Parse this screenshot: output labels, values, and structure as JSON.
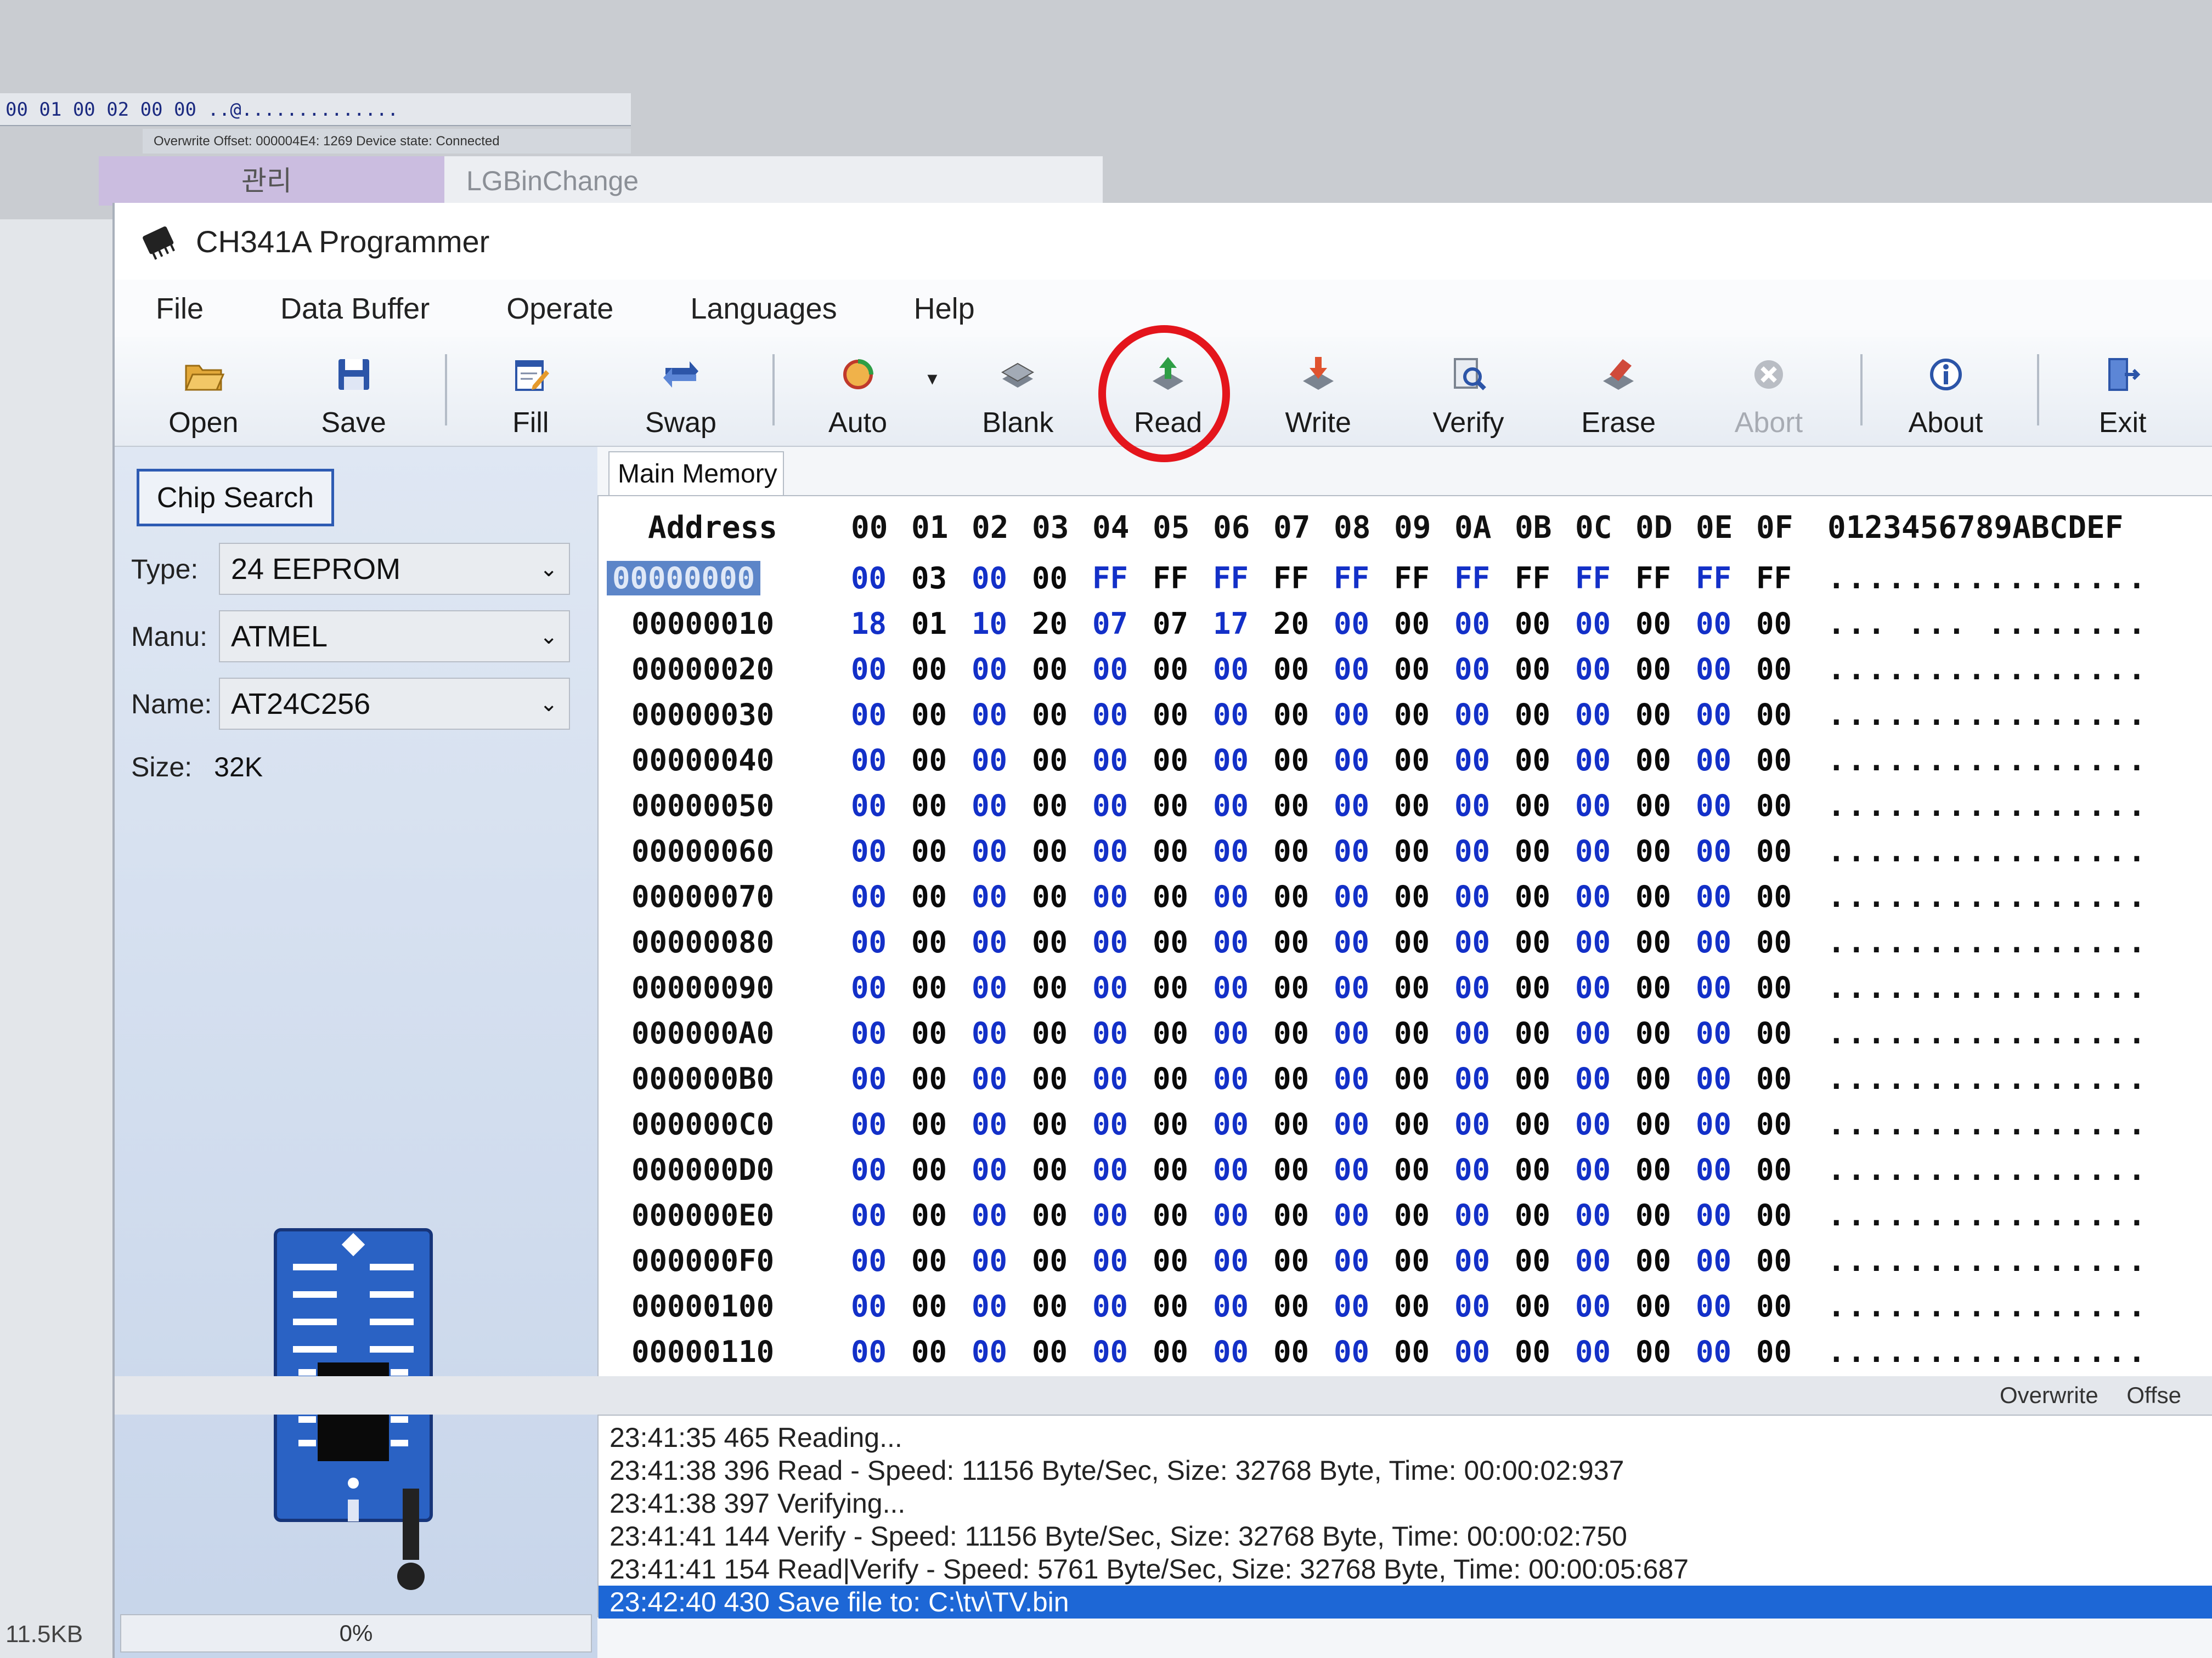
{
  "background": {
    "hex_preview": "00 01 00 02 00 00   ..@..............",
    "status_text": "Overwrite    Offset: 000004E4: 1269    Device state: Connected",
    "tabs": [
      "관리",
      "LGBinChange"
    ],
    "file_size": "11.5KB"
  },
  "window": {
    "title": "CH341A Programmer",
    "icon": "chip-icon"
  },
  "menu": [
    "File",
    "Data Buffer",
    "Operate",
    "Languages",
    "Help"
  ],
  "toolbar": {
    "open": "Open",
    "save": "Save",
    "fill": "Fill",
    "swap": "Swap",
    "auto": "Auto",
    "blank": "Blank",
    "read": "Read",
    "write": "Write",
    "verify": "Verify",
    "erase": "Erase",
    "abort": "Abort",
    "about": "About",
    "exit": "Exit",
    "highlight_color": "#e4151c"
  },
  "chip": {
    "search_label": "Chip Search",
    "type_label": "Type:",
    "type_value": "24 EEPROM",
    "manu_label": "Manu:",
    "manu_value": "ATMEL",
    "name_label": "Name:",
    "name_value": "AT24C256",
    "size_label": "Size:",
    "size_value": "32K"
  },
  "progress": {
    "value": 0,
    "text": "0%"
  },
  "memory": {
    "tab_label": "Main Memory",
    "address_header": "Address",
    "columns": [
      "00",
      "01",
      "02",
      "03",
      "04",
      "05",
      "06",
      "07",
      "08",
      "09",
      "0A",
      "0B",
      "0C",
      "0D",
      "0E",
      "0F"
    ],
    "ascii_header": "0123456789ABCDEF",
    "rows": [
      {
        "addr": "00000000",
        "bytes": [
          "00",
          "03",
          "00",
          "00",
          "FF",
          "FF",
          "FF",
          "FF",
          "FF",
          "FF",
          "FF",
          "FF",
          "FF",
          "FF",
          "FF",
          "FF"
        ],
        "ascii": "................"
      },
      {
        "addr": "00000010",
        "bytes": [
          "18",
          "01",
          "10",
          "20",
          "07",
          "07",
          "17",
          "20",
          "00",
          "00",
          "00",
          "00",
          "00",
          "00",
          "00",
          "00"
        ],
        "ascii": "... ... ........"
      },
      {
        "addr": "00000020",
        "bytes": [
          "00",
          "00",
          "00",
          "00",
          "00",
          "00",
          "00",
          "00",
          "00",
          "00",
          "00",
          "00",
          "00",
          "00",
          "00",
          "00"
        ],
        "ascii": "................"
      },
      {
        "addr": "00000030",
        "bytes": [
          "00",
          "00",
          "00",
          "00",
          "00",
          "00",
          "00",
          "00",
          "00",
          "00",
          "00",
          "00",
          "00",
          "00",
          "00",
          "00"
        ],
        "ascii": "................"
      },
      {
        "addr": "00000040",
        "bytes": [
          "00",
          "00",
          "00",
          "00",
          "00",
          "00",
          "00",
          "00",
          "00",
          "00",
          "00",
          "00",
          "00",
          "00",
          "00",
          "00"
        ],
        "ascii": "................"
      },
      {
        "addr": "00000050",
        "bytes": [
          "00",
          "00",
          "00",
          "00",
          "00",
          "00",
          "00",
          "00",
          "00",
          "00",
          "00",
          "00",
          "00",
          "00",
          "00",
          "00"
        ],
        "ascii": "................"
      },
      {
        "addr": "00000060",
        "bytes": [
          "00",
          "00",
          "00",
          "00",
          "00",
          "00",
          "00",
          "00",
          "00",
          "00",
          "00",
          "00",
          "00",
          "00",
          "00",
          "00"
        ],
        "ascii": "................"
      },
      {
        "addr": "00000070",
        "bytes": [
          "00",
          "00",
          "00",
          "00",
          "00",
          "00",
          "00",
          "00",
          "00",
          "00",
          "00",
          "00",
          "00",
          "00",
          "00",
          "00"
        ],
        "ascii": "................"
      },
      {
        "addr": "00000080",
        "bytes": [
          "00",
          "00",
          "00",
          "00",
          "00",
          "00",
          "00",
          "00",
          "00",
          "00",
          "00",
          "00",
          "00",
          "00",
          "00",
          "00"
        ],
        "ascii": "................"
      },
      {
        "addr": "00000090",
        "bytes": [
          "00",
          "00",
          "00",
          "00",
          "00",
          "00",
          "00",
          "00",
          "00",
          "00",
          "00",
          "00",
          "00",
          "00",
          "00",
          "00"
        ],
        "ascii": "................"
      },
      {
        "addr": "000000A0",
        "bytes": [
          "00",
          "00",
          "00",
          "00",
          "00",
          "00",
          "00",
          "00",
          "00",
          "00",
          "00",
          "00",
          "00",
          "00",
          "00",
          "00"
        ],
        "ascii": "................"
      },
      {
        "addr": "000000B0",
        "bytes": [
          "00",
          "00",
          "00",
          "00",
          "00",
          "00",
          "00",
          "00",
          "00",
          "00",
          "00",
          "00",
          "00",
          "00",
          "00",
          "00"
        ],
        "ascii": "................"
      },
      {
        "addr": "000000C0",
        "bytes": [
          "00",
          "00",
          "00",
          "00",
          "00",
          "00",
          "00",
          "00",
          "00",
          "00",
          "00",
          "00",
          "00",
          "00",
          "00",
          "00"
        ],
        "ascii": "................"
      },
      {
        "addr": "000000D0",
        "bytes": [
          "00",
          "00",
          "00",
          "00",
          "00",
          "00",
          "00",
          "00",
          "00",
          "00",
          "00",
          "00",
          "00",
          "00",
          "00",
          "00"
        ],
        "ascii": "................"
      },
      {
        "addr": "000000E0",
        "bytes": [
          "00",
          "00",
          "00",
          "00",
          "00",
          "00",
          "00",
          "00",
          "00",
          "00",
          "00",
          "00",
          "00",
          "00",
          "00",
          "00"
        ],
        "ascii": "................"
      },
      {
        "addr": "000000F0",
        "bytes": [
          "00",
          "00",
          "00",
          "00",
          "00",
          "00",
          "00",
          "00",
          "00",
          "00",
          "00",
          "00",
          "00",
          "00",
          "00",
          "00"
        ],
        "ascii": "................"
      },
      {
        "addr": "00000100",
        "bytes": [
          "00",
          "00",
          "00",
          "00",
          "00",
          "00",
          "00",
          "00",
          "00",
          "00",
          "00",
          "00",
          "00",
          "00",
          "00",
          "00"
        ],
        "ascii": "................"
      },
      {
        "addr": "00000110",
        "bytes": [
          "00",
          "00",
          "00",
          "00",
          "00",
          "00",
          "00",
          "00",
          "00",
          "00",
          "00",
          "00",
          "00",
          "00",
          "00",
          "00"
        ],
        "ascii": "................"
      }
    ]
  },
  "log": [
    "23:41:35 465 Reading...",
    "23:41:38 396 Read - Speed: 11156 Byte/Sec, Size: 32768 Byte, Time: 00:00:02:937",
    "23:41:38 397 Verifying...",
    "23:41:41 144 Verify - Speed: 11156 Byte/Sec, Size: 32768 Byte, Time: 00:00:02:750",
    "23:41:41 154 Read|Verify - Speed: 5761 Byte/Sec, Size: 32768 Byte, Time: 00:00:05:687",
    "23:42:40 430 Save file to: C:\\tv\\TV.bin"
  ],
  "statusbar": {
    "mode": "Overwrite",
    "offset_label": "Offse"
  }
}
